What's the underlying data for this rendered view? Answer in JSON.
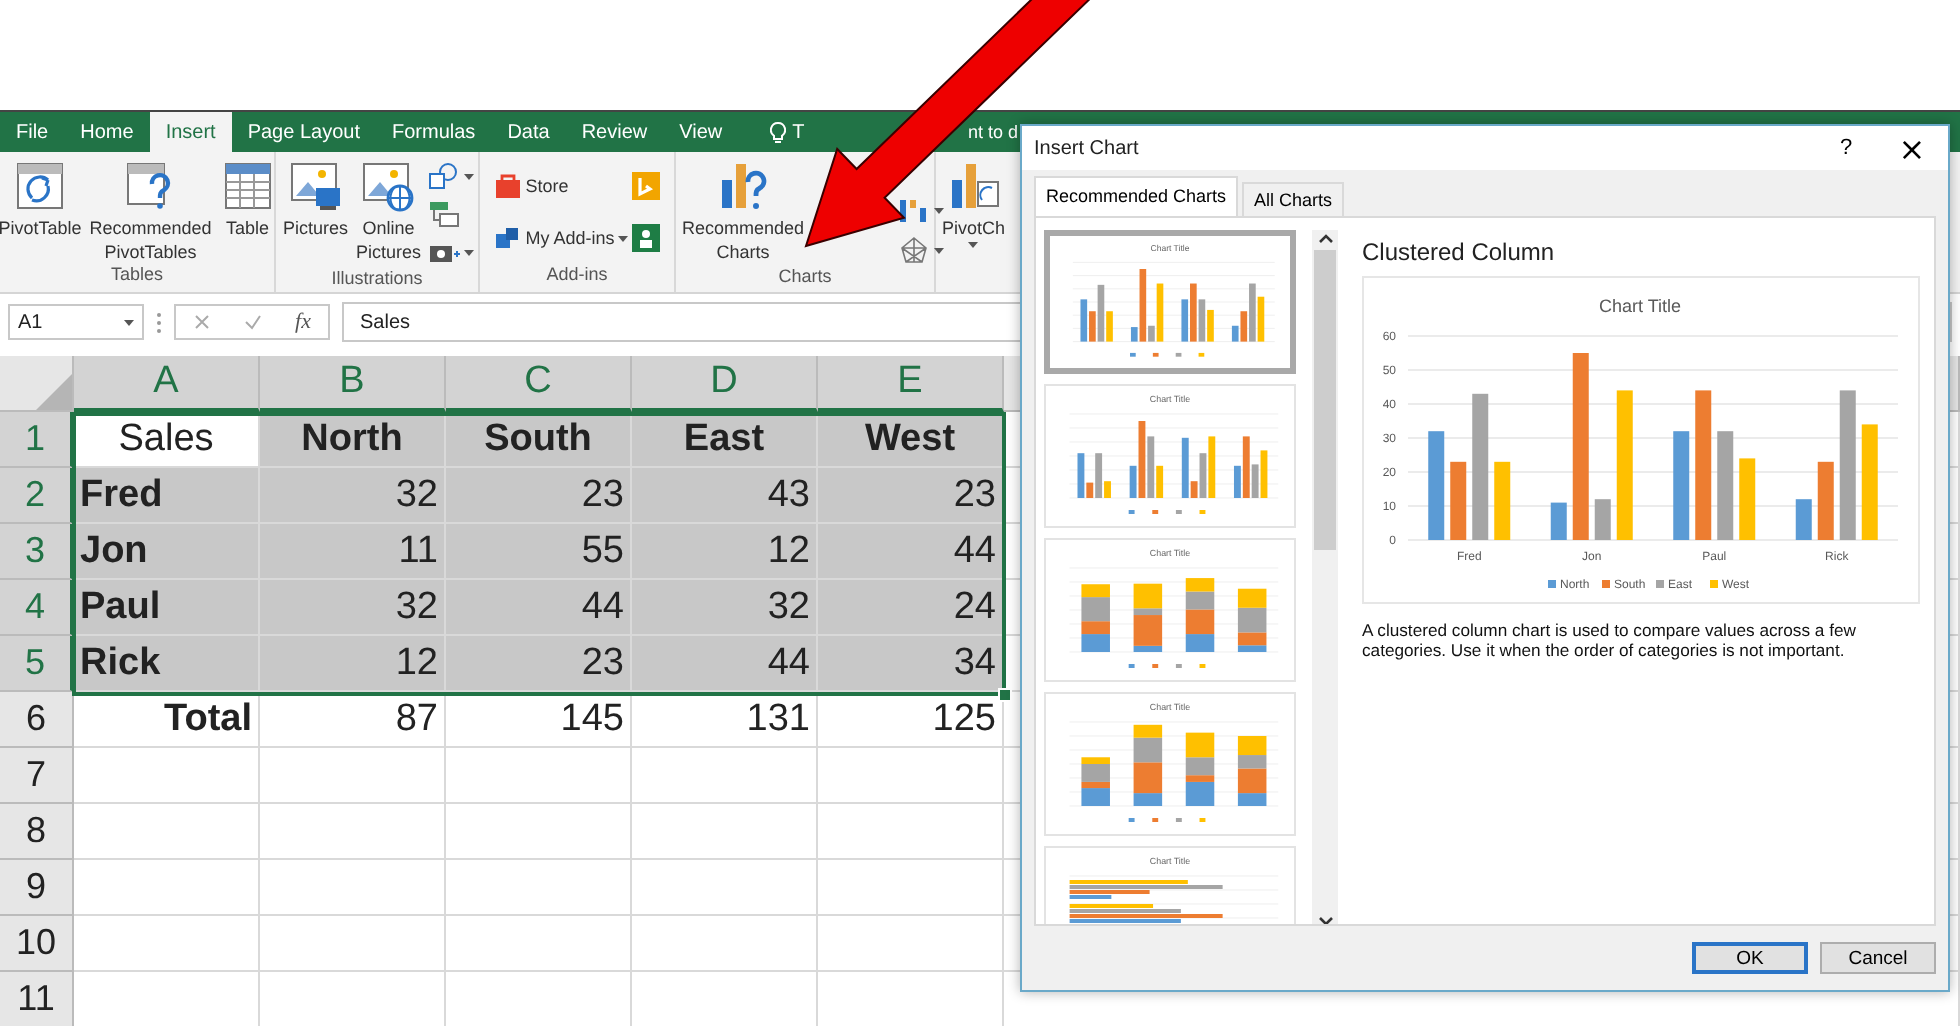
{
  "window": {
    "tabs": [
      {
        "label": "File",
        "selected": false
      },
      {
        "label": "Home",
        "selected": false
      },
      {
        "label": "Insert",
        "selected": true
      },
      {
        "label": "Page Layout",
        "selected": false
      },
      {
        "label": "Formulas",
        "selected": false
      },
      {
        "label": "Data",
        "selected": false
      },
      {
        "label": "Review",
        "selected": false
      },
      {
        "label": "View",
        "selected": false
      }
    ],
    "tell_me": [
      "T",
      "nt to d"
    ]
  },
  "ribbon": {
    "groups": [
      {
        "kind": "tables",
        "label": "Tables",
        "buttons": [
          {
            "kind": "pivot-table",
            "label": "PivotTable"
          },
          {
            "kind": "recommended-pivot",
            "label": "Recommended PivotTables"
          },
          {
            "kind": "table",
            "label": "Table"
          }
        ]
      },
      {
        "kind": "illustrations",
        "label": "Illustrations",
        "buttons": [
          {
            "kind": "pictures",
            "label": "Pictures"
          },
          {
            "kind": "online-pictures",
            "label": "Online Pictures"
          }
        ]
      },
      {
        "kind": "addins",
        "label": "Add-ins",
        "buttons": [
          {
            "kind": "store",
            "label": "Store"
          },
          {
            "kind": "my-addins",
            "label": "My Add-ins"
          }
        ]
      },
      {
        "kind": "charts",
        "label": "Charts",
        "buttons": [
          {
            "kind": "recommended-charts",
            "label": "Recommended Charts"
          }
        ]
      },
      {
        "kind": "pivotchart",
        "buttons": [
          {
            "kind": "pivot-chart",
            "label": "PivotCh"
          }
        ]
      }
    ]
  },
  "formula_bar": {
    "name_box": "A1",
    "function_label": "fx",
    "value": "Sales"
  },
  "sheet": {
    "columns": [
      {
        "label": "A",
        "selected": true
      },
      {
        "label": "B",
        "selected": true
      },
      {
        "label": "C",
        "selected": true
      },
      {
        "label": "D",
        "selected": true
      },
      {
        "label": "E",
        "selected": true
      }
    ],
    "rows": [
      {
        "label": "1",
        "selected": true,
        "cells": [
          {
            "text": "Sales",
            "kind": "title",
            "active": true
          },
          {
            "text": "North",
            "kind": "header",
            "active": false
          },
          {
            "text": "South",
            "kind": "header",
            "active": false
          },
          {
            "text": "East",
            "kind": "header",
            "active": false
          },
          {
            "text": "West",
            "kind": "header",
            "active": false
          }
        ]
      },
      {
        "label": "2",
        "selected": true,
        "cells": [
          {
            "text": "Fred",
            "kind": "label",
            "active": false
          },
          {
            "text": "32",
            "kind": "number",
            "active": false
          },
          {
            "text": "23",
            "kind": "number",
            "active": false
          },
          {
            "text": "43",
            "kind": "number",
            "active": false
          },
          {
            "text": "23",
            "kind": "number",
            "active": false
          }
        ]
      },
      {
        "label": "3",
        "selected": true,
        "cells": [
          {
            "text": "Jon",
            "kind": "label",
            "active": false
          },
          {
            "text": "11",
            "kind": "number",
            "active": false
          },
          {
            "text": "55",
            "kind": "number",
            "active": false
          },
          {
            "text": "12",
            "kind": "number",
            "active": false
          },
          {
            "text": "44",
            "kind": "number",
            "active": false
          }
        ]
      },
      {
        "label": "4",
        "selected": true,
        "cells": [
          {
            "text": "Paul",
            "kind": "label",
            "active": false
          },
          {
            "text": "32",
            "kind": "number",
            "active": false
          },
          {
            "text": "44",
            "kind": "number",
            "active": false
          },
          {
            "text": "32",
            "kind": "number",
            "active": false
          },
          {
            "text": "24",
            "kind": "number",
            "active": false
          }
        ]
      },
      {
        "label": "5",
        "selected": true,
        "cells": [
          {
            "text": "Rick",
            "kind": "label",
            "active": false
          },
          {
            "text": "12",
            "kind": "number",
            "active": false
          },
          {
            "text": "23",
            "kind": "number",
            "active": false
          },
          {
            "text": "44",
            "kind": "number",
            "active": false
          },
          {
            "text": "34",
            "kind": "number",
            "active": false
          }
        ]
      },
      {
        "label": "6",
        "selected": false,
        "cells": [
          {
            "text": "Total",
            "kind": "total",
            "active": false
          },
          {
            "text": "87",
            "kind": "number",
            "active": false
          },
          {
            "text": "145",
            "kind": "number",
            "active": false
          },
          {
            "text": "131",
            "kind": "number",
            "active": false
          },
          {
            "text": "125",
            "kind": "number",
            "active": false
          }
        ]
      },
      {
        "label": "7",
        "selected": false
      },
      {
        "label": "8",
        "selected": false
      },
      {
        "label": "9",
        "selected": false
      },
      {
        "label": "10",
        "selected": false
      },
      {
        "label": "11",
        "selected": false
      }
    ]
  },
  "dialog": {
    "title": "Insert Chart",
    "help": "?",
    "close": "×",
    "tabs": [
      {
        "label": "Recommended Charts",
        "selected": true
      },
      {
        "label": "All Charts",
        "selected": false
      }
    ],
    "thumbnails": [
      {
        "kind": "clustered",
        "title": "Chart Title",
        "selected": true
      },
      {
        "kind": "clustered-swapped",
        "title": "Chart Title",
        "selected": false
      },
      {
        "kind": "stacked",
        "title": "Chart Title",
        "selected": false
      },
      {
        "kind": "stacked-swapped",
        "title": "Chart Title",
        "selected": false
      },
      {
        "kind": "bar",
        "title": "Chart Title",
        "selected": false
      }
    ],
    "heading": "Clustered Column",
    "preview": {
      "chart_data": {
        "type": "bar",
        "title": "Chart Title",
        "categories": [
          "Fred",
          "Jon",
          "Paul",
          "Rick"
        ],
        "series": [
          {
            "name": "North",
            "color": "#5b9bd5",
            "values": [
              32,
              11,
              32,
              12
            ]
          },
          {
            "name": "South",
            "color": "#ed7d31",
            "values": [
              23,
              55,
              44,
              23
            ]
          },
          {
            "name": "East",
            "color": "#a5a5a5",
            "values": [
              43,
              12,
              32,
              44
            ]
          },
          {
            "name": "West",
            "color": "#ffc000",
            "values": [
              23,
              44,
              24,
              34
            ]
          }
        ],
        "ylim": [
          0,
          60
        ],
        "yticks": [
          0,
          10,
          20,
          30,
          40,
          50,
          60
        ],
        "grid": true,
        "legend": "bottom"
      }
    },
    "description": "A clustered column chart is used to compare values across a few categories. Use it when the order of categories is not important.",
    "buttons": [
      {
        "label": "OK",
        "default": true
      },
      {
        "label": "Cancel",
        "default": false
      }
    ]
  }
}
